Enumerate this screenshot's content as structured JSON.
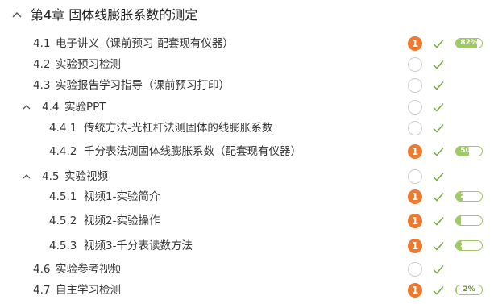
{
  "chapter": {
    "title": "第4章  固体线膨胀系数的测定"
  },
  "colors": {
    "badge": "#ee7a2f",
    "check": "#7caa3e",
    "progress_fill": "#9ccc5e",
    "progress_border": "#a2c36a"
  },
  "items": [
    {
      "num": "4.1",
      "label": "电子讲义（课前预习-配套现有仪器）",
      "level": 1,
      "collapsible": false,
      "badge": "1",
      "status": "badge",
      "progress": "82%",
      "progress_value": 82
    },
    {
      "num": "4.2",
      "label": "实验预习检测",
      "level": 1,
      "collapsible": false,
      "badge": null,
      "status": "circle",
      "progress": null
    },
    {
      "num": "4.3",
      "label": "实验报告学习指导（课前预习打印）",
      "level": 1,
      "collapsible": false,
      "badge": null,
      "status": "circle",
      "progress": null
    },
    {
      "num": "4.4",
      "label": "实验PPT",
      "level": 1,
      "collapsible": true,
      "badge": null,
      "status": "circle",
      "progress": null
    },
    {
      "num": "4.4.1",
      "label": "传统方法-光杠杆法测固体的线膨胀系数",
      "level": 2,
      "collapsible": false,
      "badge": null,
      "status": "circle",
      "progress": null
    },
    {
      "num": "4.4.2",
      "label": "千分表法测固体线膨胀系数（配套现有仪器）",
      "level": 2,
      "collapsible": false,
      "badge": "1",
      "status": "badge",
      "progress": "50%",
      "progress_value": 50
    },
    {
      "num": "4.5",
      "label": "实验视频",
      "level": 1,
      "collapsible": true,
      "badge": null,
      "status": "circle",
      "progress": null
    },
    {
      "num": "4.5.1",
      "label": "视频1-实验简介",
      "level": 2,
      "collapsible": false,
      "badge": "1",
      "status": "badge",
      "progress": "26%",
      "progress_value": 26
    },
    {
      "num": "4.5.2",
      "label": "视频2-实验操作",
      "level": 2,
      "collapsible": false,
      "badge": "1",
      "status": "badge",
      "progress": "20%",
      "progress_value": 20
    },
    {
      "num": "4.5.3",
      "label": "视频3-千分表读数方法",
      "level": 2,
      "collapsible": false,
      "badge": "1",
      "status": "badge",
      "progress": "23%",
      "progress_value": 23
    },
    {
      "num": "4.6",
      "label": "实验参考视频",
      "level": 1,
      "collapsible": false,
      "badge": null,
      "status": "circle",
      "progress": null
    },
    {
      "num": "4.7",
      "label": "自主学习检测",
      "level": 1,
      "collapsible": false,
      "badge": "1",
      "status": "badge",
      "progress": "2%",
      "progress_value": 2
    }
  ]
}
